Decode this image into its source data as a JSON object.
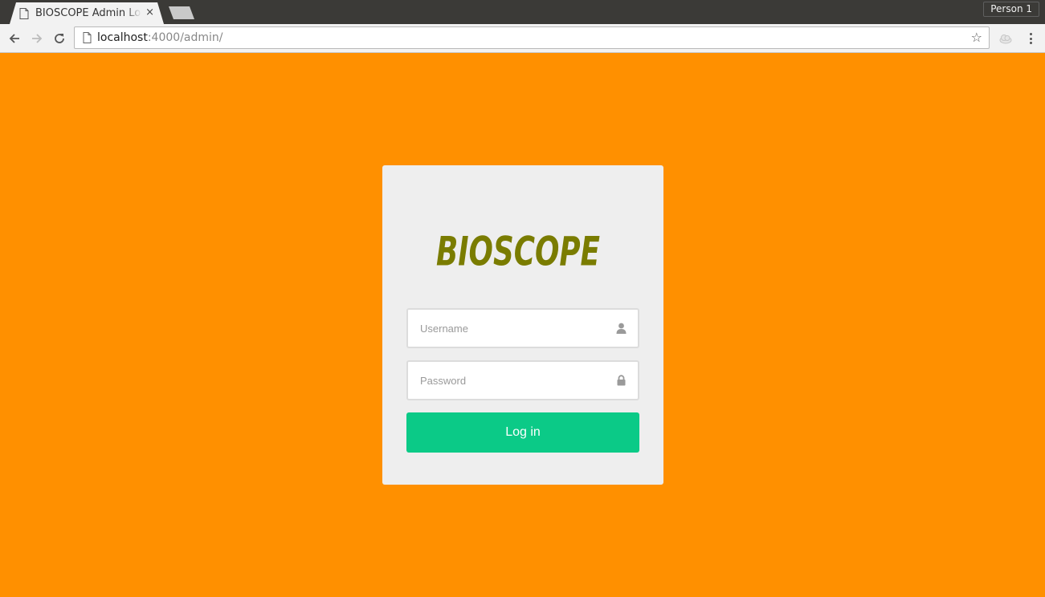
{
  "browser": {
    "tab_title": "BIOSCOPE Admin Login",
    "tab_close": "×",
    "profile_label": "Person 1",
    "url_host": "localhost",
    "url_rest": ":4000/admin/",
    "star": "☆"
  },
  "login": {
    "logo_text": "BIOSCOPE",
    "logo_color": "#7a7c00",
    "username_placeholder": "Username",
    "password_placeholder": "Password",
    "login_button": "Log in",
    "username_icon": "user-icon",
    "password_icon": "lock-icon"
  },
  "colors": {
    "page_background": "#ff9000",
    "card_background": "#eeeeee",
    "button_background": "#0bca87"
  }
}
